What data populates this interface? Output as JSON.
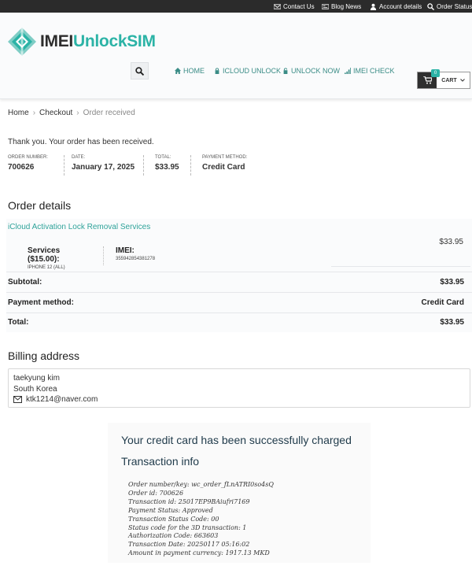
{
  "topbar": {
    "contact": "Contact Us",
    "blog": "Blog News",
    "account": "Account details",
    "order_status": "Order Status"
  },
  "logo": {
    "part1": "IMEI",
    "part2": "UnlockSIM"
  },
  "nav": {
    "home": "HOME",
    "icloud": "ICLOUD UNLOCK",
    "unlock": "UNLOCK NOW",
    "imei": "IMEI CHECK"
  },
  "cart": {
    "label": "CART",
    "count": "0"
  },
  "breadcrumb": {
    "home": "Home",
    "checkout": "Checkout",
    "current": "Order received"
  },
  "thank_you": "Thank you. Your order has been received.",
  "overview": [
    {
      "label": "ORDER NUMBER:",
      "value": "700626"
    },
    {
      "label": "DATE:",
      "value": "January 17, 2025"
    },
    {
      "label": "TOTAL:",
      "value": "$33.95"
    },
    {
      "label": "PAYMENT METHOD:",
      "value": "Credit Card"
    }
  ],
  "order_details": {
    "title": "Order details",
    "product": "iCloud Activation Lock Removal Services",
    "product_price": "$33.95",
    "services_label": "Services ($15.00):",
    "services_value": "IPHONE 12 (ALL)",
    "imei_label": "IMEI:",
    "imei_value": "355942854381278",
    "subtotal_label": "Subtotal:",
    "subtotal_value": "$33.95",
    "payment_label": "Payment method:",
    "payment_value": "Credit Card",
    "total_label": "Total:",
    "total_value": "$33.95"
  },
  "billing": {
    "title": "Billing address",
    "name": "taekyung kim",
    "country": "South Korea",
    "email": "ktk1214@naver.com"
  },
  "transaction": {
    "charged": "Your credit card has been successfully charged",
    "title": "Transaction info",
    "lines": [
      "Order number/key: wc_order_fLnATRI0so4sQ",
      "Order id: 700626",
      "Transaction id: 25017EP9BAiufri7169",
      "Payment Status: Approved",
      "Transaction Status Code: 00",
      "Status code for the 3D transaction: 1",
      "Authorization Code: 663603",
      "Transaction Date: 20250117 05:16:02",
      "Amount in payment currency: 1917.13 MKD"
    ]
  },
  "colors": {
    "accent": "#2bb3a6",
    "link": "#2fa39a",
    "topbar": "#2b2b2b"
  },
  "icons": [
    "envelope-icon",
    "newspaper-icon",
    "user-icon",
    "search-icon",
    "home-icon",
    "lock-icon",
    "unlock-icon",
    "signal-icon",
    "cart-icon",
    "chevron-down-icon",
    "mail-icon",
    "logo-diamond-icon"
  ]
}
